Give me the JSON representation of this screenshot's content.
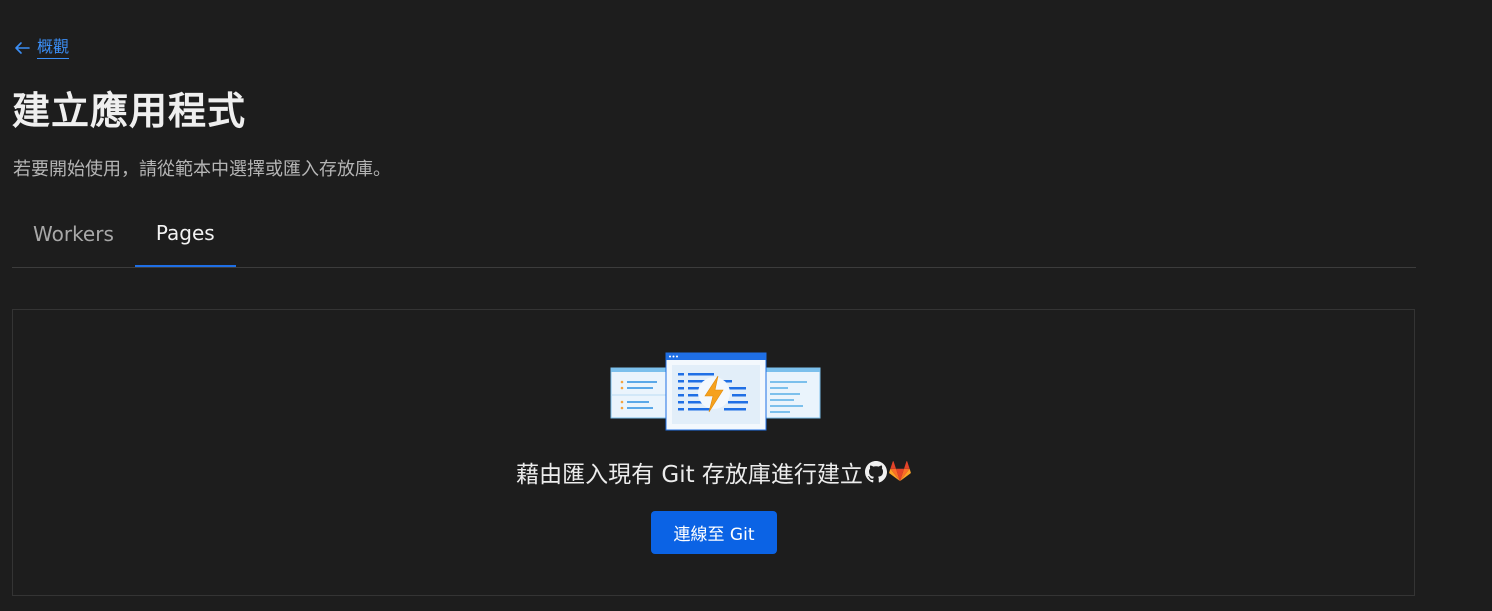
{
  "header": {
    "back_label": "概觀",
    "title": "建立應用程式",
    "subtitle": "若要開始使用，請從範本中選擇或匯入存放庫。"
  },
  "tabs": [
    {
      "label": "Workers",
      "active": false
    },
    {
      "label": "Pages",
      "active": true
    }
  ],
  "git_import": {
    "headline": "藉由匯入現有 Git 存放庫進行建立",
    "providers": [
      "github-icon",
      "gitlab-icon"
    ],
    "button_label": "連線至 Git"
  },
  "colors": {
    "background": "#1d1d1d",
    "accent": "#0b63e5",
    "link": "#3b8ef5",
    "bolt": "#f6a11c"
  }
}
